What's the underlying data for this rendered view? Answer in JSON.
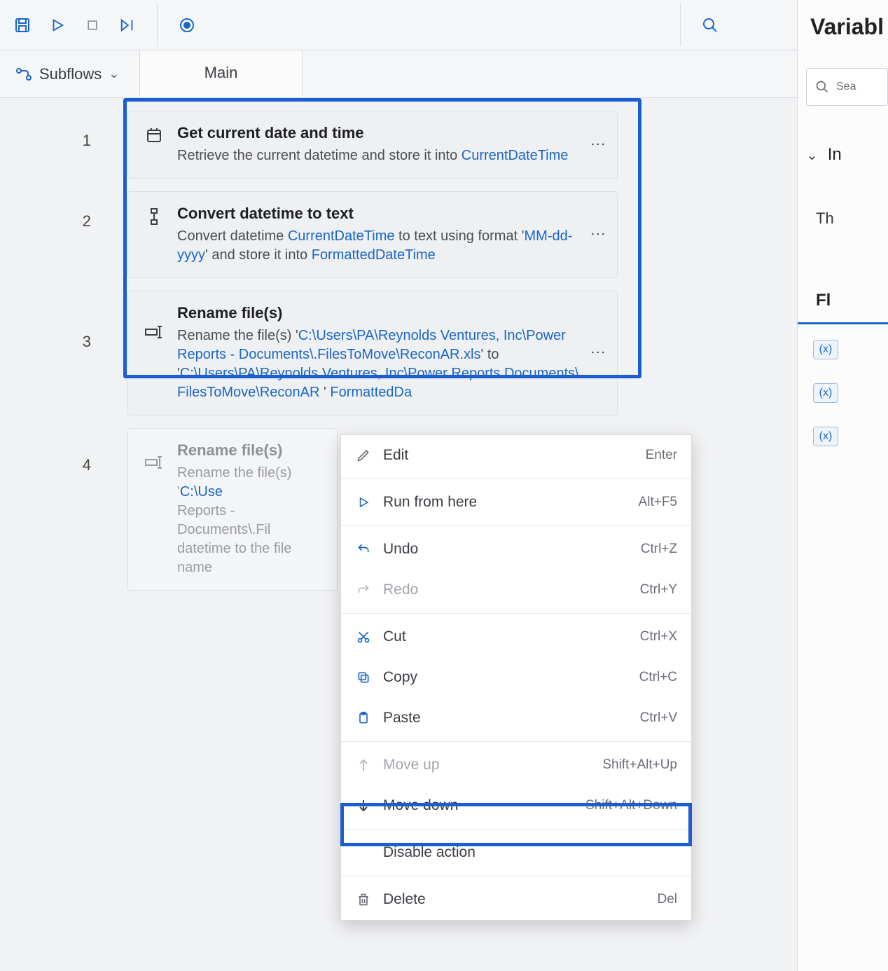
{
  "toolbar": {
    "search_icon": "search"
  },
  "subbar": {
    "subflows_label": "Subflows",
    "tab_main": "Main"
  },
  "right": {
    "title": "Variabl",
    "search_placeholder": "Sea",
    "section_in": "In",
    "txt_th": "Th",
    "fl_tab": "Fl",
    "var_chip": "(x)"
  },
  "steps": [
    {
      "num": "1",
      "title": "Get current date and time",
      "desc_pre": "Retrieve the current datetime and store it into ",
      "v1": "CurrentDateTime"
    },
    {
      "num": "2",
      "title": "Convert datetime to text",
      "d1": "Convert datetime ",
      "v1": "CurrentDateTime",
      "d2": " to text using format '",
      "q1": "MM-dd-yyyy",
      "d3": "' and store it into ",
      "v2": "FormattedDateTime"
    },
    {
      "num": "3",
      "title": "Rename file(s)",
      "d1": "Rename the file(s) '",
      "q1": "C:\\Users\\PA\\Reynolds Ventures, Inc\\Power Reports - Documents\\.FilesToMove\\ReconAR.xls",
      "d2": "' to '",
      "q2": "C:\\Users\\PA\\Reynolds Ventures, Inc\\Power Reports   Documents\\ FilesToMove\\ReconAR",
      "d3": " ' ",
      "v1": "FormattedDa"
    },
    {
      "num": "4",
      "title": "Rename file(s)",
      "d1": "Rename the file(s) '",
      "q1": "C:\\Use",
      "d2": "Reports - Documents\\.Fil",
      "d3": "datetime to the file name"
    }
  ],
  "menu": {
    "edit": "Edit",
    "edit_s": "Enter",
    "run": "Run from here",
    "run_s": "Alt+F5",
    "undo": "Undo",
    "undo_s": "Ctrl+Z",
    "redo": "Redo",
    "redo_s": "Ctrl+Y",
    "cut": "Cut",
    "cut_s": "Ctrl+X",
    "copy": "Copy",
    "copy_s": "Ctrl+C",
    "paste": "Paste",
    "paste_s": "Ctrl+V",
    "moveup": "Move up",
    "moveup_s": "Shift+Alt+Up",
    "movedown": "Move down",
    "movedown_s": "Shift+Alt+Down",
    "disable": "Disable action",
    "delete": "Delete",
    "delete_s": "Del"
  }
}
